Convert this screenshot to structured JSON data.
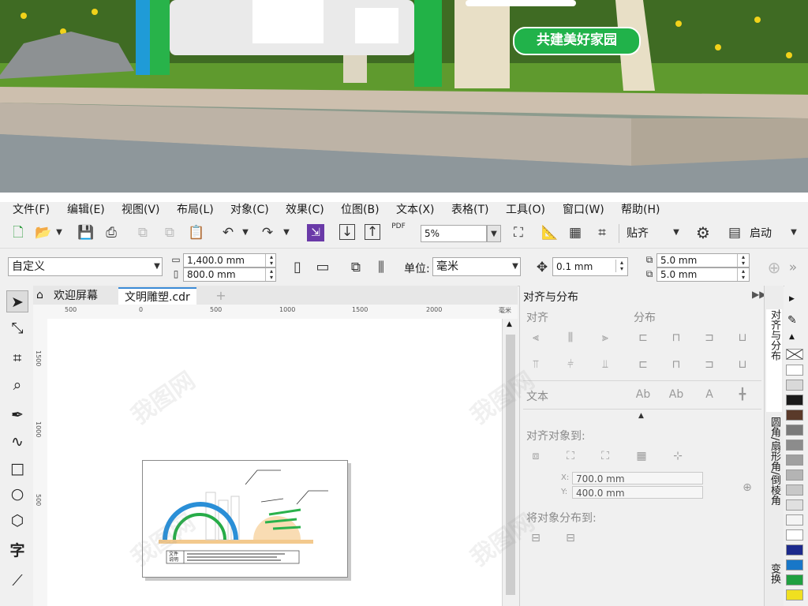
{
  "photo": {
    "sign_text": "共建美好家园"
  },
  "menu": [
    "文件(F)",
    "编辑(E)",
    "视图(V)",
    "布局(L)",
    "对象(C)",
    "效果(C)",
    "位图(B)",
    "文本(X)",
    "表格(T)",
    "工具(O)",
    "窗口(W)",
    "帮助(H)"
  ],
  "toolbar": {
    "pdf_label": "PDF",
    "zoom": "5%",
    "snap_label": "贴齐",
    "launch_label": "启动"
  },
  "property_bar": {
    "preset": "自定义",
    "width": "1,400.0 mm",
    "height": "800.0 mm",
    "unit_label": "单位:",
    "unit_value": "毫米",
    "nudge": "0.1 mm",
    "dup_x": "5.0 mm",
    "dup_y": "5.0 mm"
  },
  "tabs": {
    "welcome": "欢迎屏幕",
    "document": "文明雕塑.cdr"
  },
  "ruler": {
    "h_ticks": [
      "500",
      "0",
      "500",
      "1000",
      "1500",
      "2000"
    ],
    "h_unit": "毫米",
    "v_ticks": [
      "1500",
      "1000",
      "500"
    ]
  },
  "page_content": {
    "caption_top": "文件",
    "caption_bottom": "说明"
  },
  "docker": {
    "title": "对齐与分布",
    "align": "对齐",
    "distribute": "分布",
    "text": "文本",
    "align_to": "对齐对象到:",
    "x_label": "X:",
    "x_value": "700.0 mm",
    "y_label": "Y:",
    "y_value": "400.0 mm",
    "distribute_to": "将对象分布到:"
  },
  "side_tabs": [
    "对齐与分布",
    "圆角/扇形角/倒棱角",
    "变换"
  ],
  "palette": [
    "#ffffff",
    "#d9d9d9",
    "#1a1a1a",
    "#5a3a2a",
    "#7a7a7a",
    "#8c8c8c",
    "#a0a0a0",
    "#b4b4b4",
    "#c8c8c8",
    "#e0e0e0",
    "#f4f4f4",
    "#ffffff",
    "#1c2a8c",
    "#1877c8",
    "#20a040",
    "#f0e020"
  ],
  "watermark": "我图网"
}
